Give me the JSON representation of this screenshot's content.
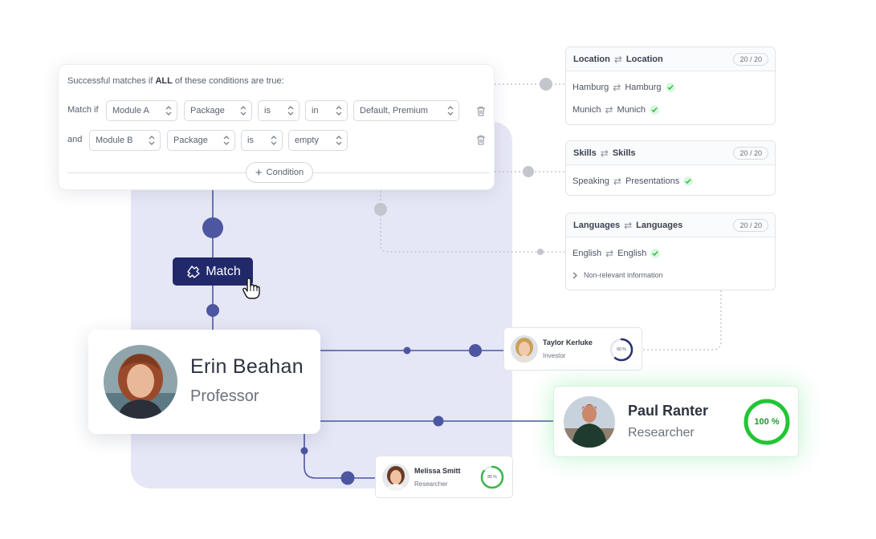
{
  "colors": {
    "accent": "#4d56a0",
    "match_button": "#22296b",
    "panel": "#e6e7f6",
    "success": "#22c534",
    "connector": "#b8bcc3"
  },
  "conditions": {
    "header_prefix": "Successful matches if ",
    "header_bold": "ALL",
    "header_suffix": " of these conditions are true:",
    "rows": [
      {
        "label": "Match if",
        "module": "Module A",
        "field": "Package",
        "operator": "is",
        "relation": "in",
        "value": "Default, Premium"
      },
      {
        "label": "and",
        "module": "Module B",
        "field": "Package",
        "operator": "is",
        "value": "empty"
      }
    ],
    "add_label": "Condition"
  },
  "mappings": [
    {
      "left": "Location",
      "right": "Location",
      "count": "20 / 20",
      "rows": [
        {
          "left": "Hamburg",
          "right": "Hamburg"
        },
        {
          "left": "Munich",
          "right": "Munich"
        }
      ]
    },
    {
      "left": "Skills",
      "right": "Skills",
      "count": "20 / 20",
      "rows": [
        {
          "left": "Speaking",
          "right": "Presentations"
        }
      ]
    },
    {
      "left": "Languages",
      "right": "Languages",
      "count": "20 / 20",
      "rows": [
        {
          "left": "English",
          "right": "English"
        }
      ],
      "extra": "Non-relevant information"
    }
  ],
  "match_button": {
    "label": "Match",
    "icon": "puzzle-icon"
  },
  "people": {
    "erin": {
      "name": "Erin Beahan",
      "role": "Professor"
    },
    "taylor": {
      "name": "Taylor Kerluke",
      "role": "Investor",
      "score_label": "60 %",
      "score": 0.6
    },
    "paul": {
      "name": "Paul Ranter",
      "role": "Researcher",
      "score_label": "100 %",
      "score": 1.0
    },
    "melissa": {
      "name": "Melissa Smitt",
      "role": "Researcher",
      "score_label": "85 %",
      "score": 0.85
    }
  }
}
